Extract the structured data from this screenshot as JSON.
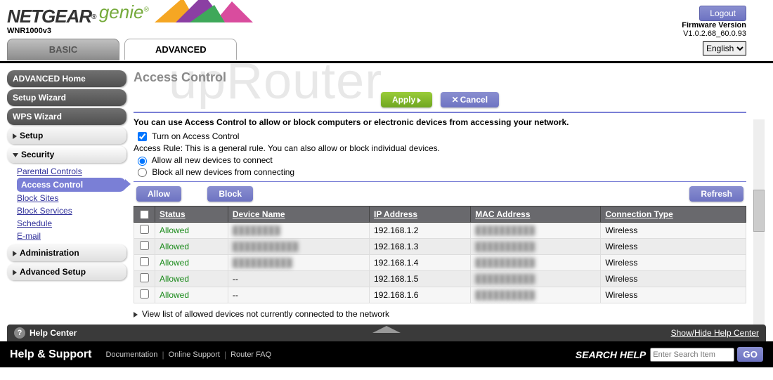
{
  "header": {
    "brand": "NETGEAR",
    "product": "genie",
    "model": "WNR1000v3",
    "logout": "Logout",
    "firmware_label": "Firmware Version",
    "firmware_value": "V1.0.2.68_60.0.93",
    "language": "English"
  },
  "tabs": {
    "basic": "BASIC",
    "advanced": "ADVANCED"
  },
  "sidebar": {
    "home": "ADVANCED Home",
    "setup_wizard": "Setup Wizard",
    "wps_wizard": "WPS Wizard",
    "setup": "Setup",
    "security": "Security",
    "sec_items": {
      "parental": "Parental Controls",
      "access": "Access Control",
      "block_sites": "Block Sites",
      "block_services": "Block Services",
      "schedule": "Schedule",
      "email": "E-mail"
    },
    "administration": "Administration",
    "advanced_setup": "Advanced Setup"
  },
  "page": {
    "title": "Access Control",
    "apply": "Apply",
    "cancel": "Cancel",
    "instruction": "You can use Access Control to allow or block computers or electronic devices from accessing your network.",
    "turn_on": "Turn on Access Control",
    "rule_text": "Access Rule: This is a general rule. You can also allow or block individual devices.",
    "radio_allow": "Allow all new devices to connect",
    "radio_block": "Block all new devices from connecting",
    "allow_btn": "Allow",
    "block_btn": "Block",
    "refresh_btn": "Refresh",
    "view_list": "View list of allowed devices not currently connected to the network",
    "columns": {
      "status": "Status",
      "device": "Device Name",
      "ip": "IP Address",
      "mac": "MAC Address",
      "conn": "Connection Type"
    },
    "rows": [
      {
        "status": "Allowed",
        "device": "████████",
        "ip": "192.168.1.2",
        "mac": "██████████",
        "conn": "Wireless"
      },
      {
        "status": "Allowed",
        "device": "███████████",
        "ip": "192.168.1.3",
        "mac": "██████████",
        "conn": "Wireless"
      },
      {
        "status": "Allowed",
        "device": "██████████",
        "ip": "192.168.1.4",
        "mac": "██████████",
        "conn": "Wireless"
      },
      {
        "status": "Allowed",
        "device": "--",
        "ip": "192.168.1.5",
        "mac": "██████████",
        "conn": "Wireless"
      },
      {
        "status": "Allowed",
        "device": "--",
        "ip": "192.168.1.6",
        "mac": "██████████",
        "conn": "Wireless"
      }
    ]
  },
  "helpbar": {
    "help_center": "Help Center",
    "showhide": "Show/Hide Help Center"
  },
  "support": {
    "title": "Help & Support",
    "l1": "Documentation",
    "l2": "Online Support",
    "l3": "Router FAQ",
    "search_label": "SEARCH HELP",
    "search_placeholder": "Enter Search Item",
    "go": "GO"
  },
  "watermark": "upRouter"
}
